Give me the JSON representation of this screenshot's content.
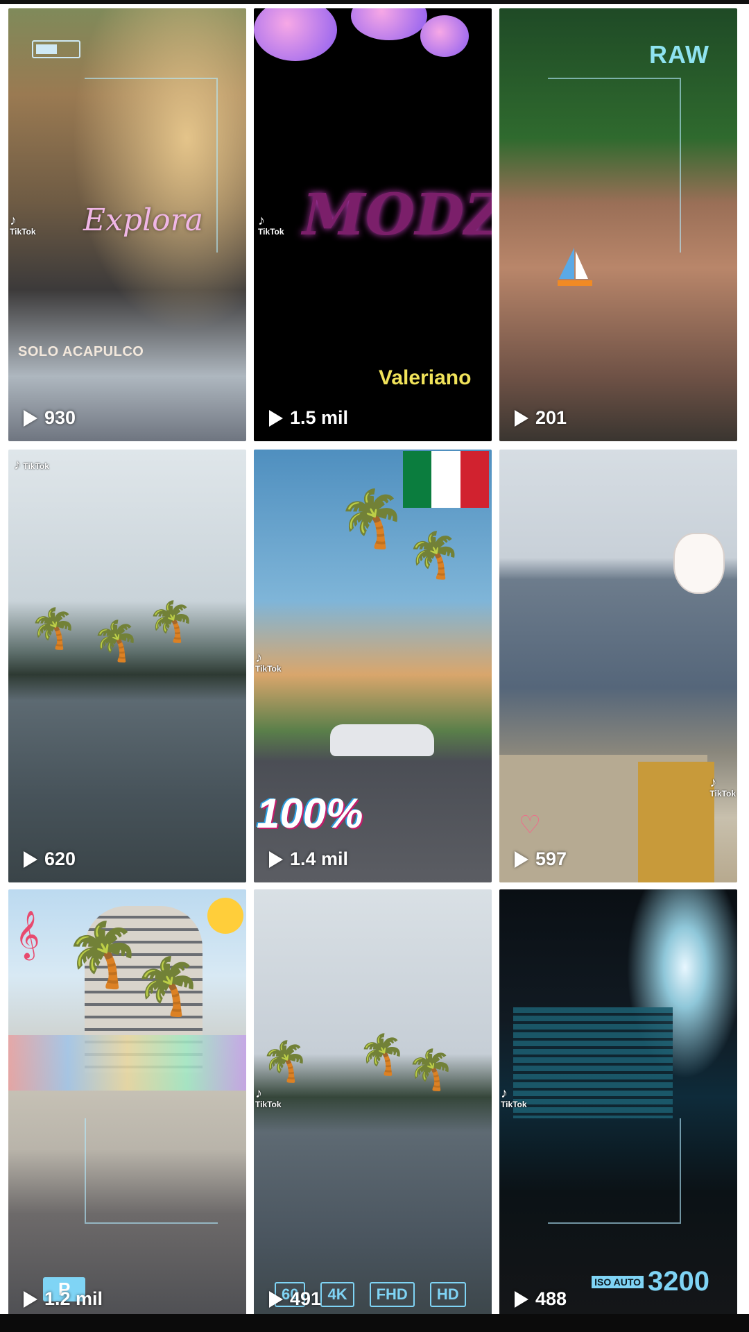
{
  "videos": [
    {
      "views": "930",
      "overlay": "Explora",
      "caption": "SOLO ACAPULCO",
      "badge": "TikTok"
    },
    {
      "views": "1.5 mil",
      "overlay": "MODZ",
      "caption": "Valeriano",
      "badge": "TikTok"
    },
    {
      "views": "201",
      "overlay": "RAW"
    },
    {
      "views": "620",
      "badge": "TikTok"
    },
    {
      "views": "1.4 mil",
      "overlay": "100%",
      "badge": "TikTok"
    },
    {
      "views": "597",
      "badge": "TikTok"
    },
    {
      "views": "1.2 mil",
      "overlay": "P"
    },
    {
      "views": "491",
      "overlay_badges": [
        "60",
        "4K",
        "FHD",
        "HD"
      ],
      "badge": "TikTok"
    },
    {
      "views": "488",
      "iso_label": "ISO AUTO",
      "iso_value": "3200",
      "badge": "TikTok"
    }
  ],
  "icons": {
    "play": "play-icon",
    "tiktok": "tiktok-logo-icon"
  },
  "colors": {
    "background": "#ffffff",
    "view_text": "#ffffff",
    "hud_cyan": "#7fd4f5"
  }
}
